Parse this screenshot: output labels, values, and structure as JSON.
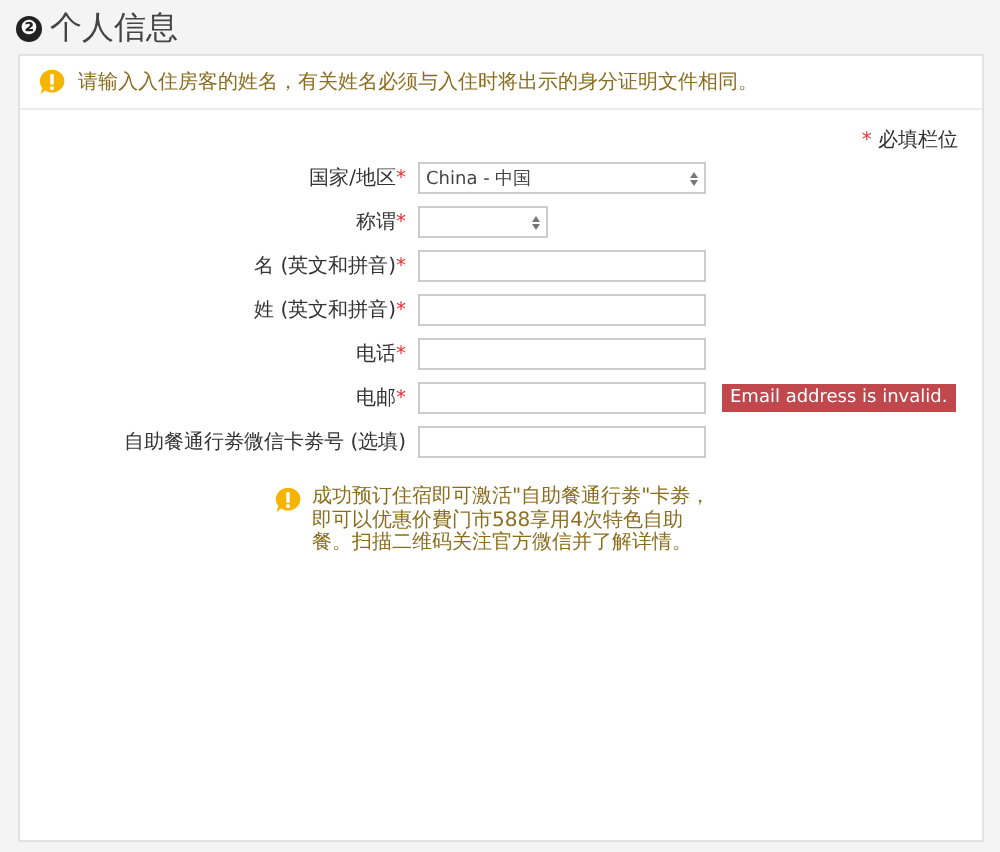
{
  "section": {
    "number": "❷",
    "title": "个人信息"
  },
  "notice": "请输入入住房客的姓名，有关姓名必须与入住时将出示的身分证明文件相同。",
  "required_note": {
    "asterisk": "*",
    "text": "必填栏位"
  },
  "fields": [
    {
      "kind": "select",
      "label": "国家/地区",
      "asterisk": "*",
      "value": "China - 中国"
    },
    {
      "kind": "short-select",
      "label": "称谓",
      "asterisk": "*"
    },
    {
      "kind": "text",
      "label": "名 (英文和拼音)",
      "asterisk": "*"
    },
    {
      "kind": "text",
      "label": "姓 (英文和拼音)",
      "asterisk": "*"
    },
    {
      "kind": "text",
      "label": "电话",
      "asterisk": "*"
    },
    {
      "kind": "text",
      "label": "电邮",
      "asterisk": "*",
      "error": "Email address is invalid."
    },
    {
      "kind": "text",
      "label": "自助餐通行劵微信卡劵号 (选填)"
    }
  ],
  "info": "成功预订住宿即可激活\"自助餐通行劵\"卡劵，即可以优惠价費门市588享用4次特色自助餐。扫描二维码关注官方微信并了解详情。"
}
